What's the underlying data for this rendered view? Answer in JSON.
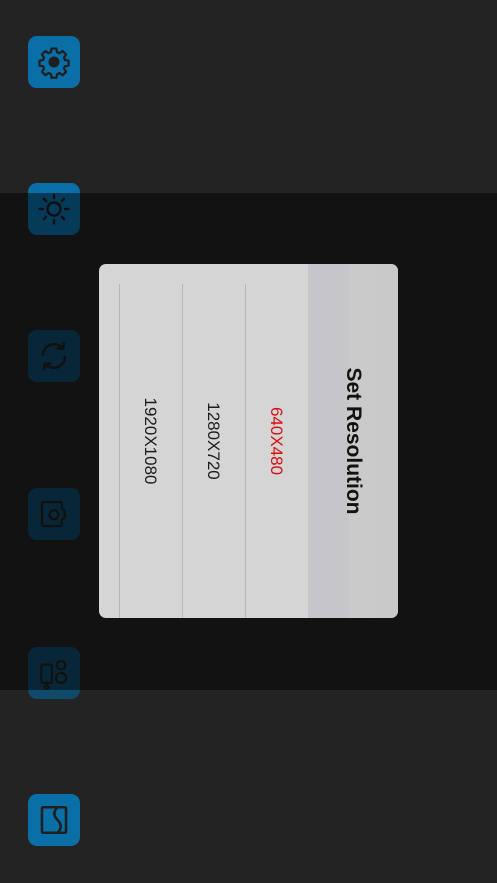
{
  "dialog": {
    "title": "Set Resolution",
    "options": [
      {
        "label": "640X480",
        "selected": true
      },
      {
        "label": "1280X720",
        "selected": false
      },
      {
        "label": "1920X1080",
        "selected": false
      }
    ]
  },
  "toolbar": {
    "buttons": [
      {
        "name": "settings",
        "icon": "gear-icon"
      },
      {
        "name": "brightness",
        "icon": "sun-icon"
      },
      {
        "name": "rotate",
        "icon": "refresh-icon"
      },
      {
        "name": "switch-camera",
        "icon": "camera-switch-icon"
      },
      {
        "name": "gallery",
        "icon": "media-icon"
      },
      {
        "name": "mirror",
        "icon": "mirror-icon"
      }
    ]
  },
  "colors": {
    "accent": "#0a6fa6",
    "selected_option": "#d60e0e",
    "background": "#232323"
  }
}
